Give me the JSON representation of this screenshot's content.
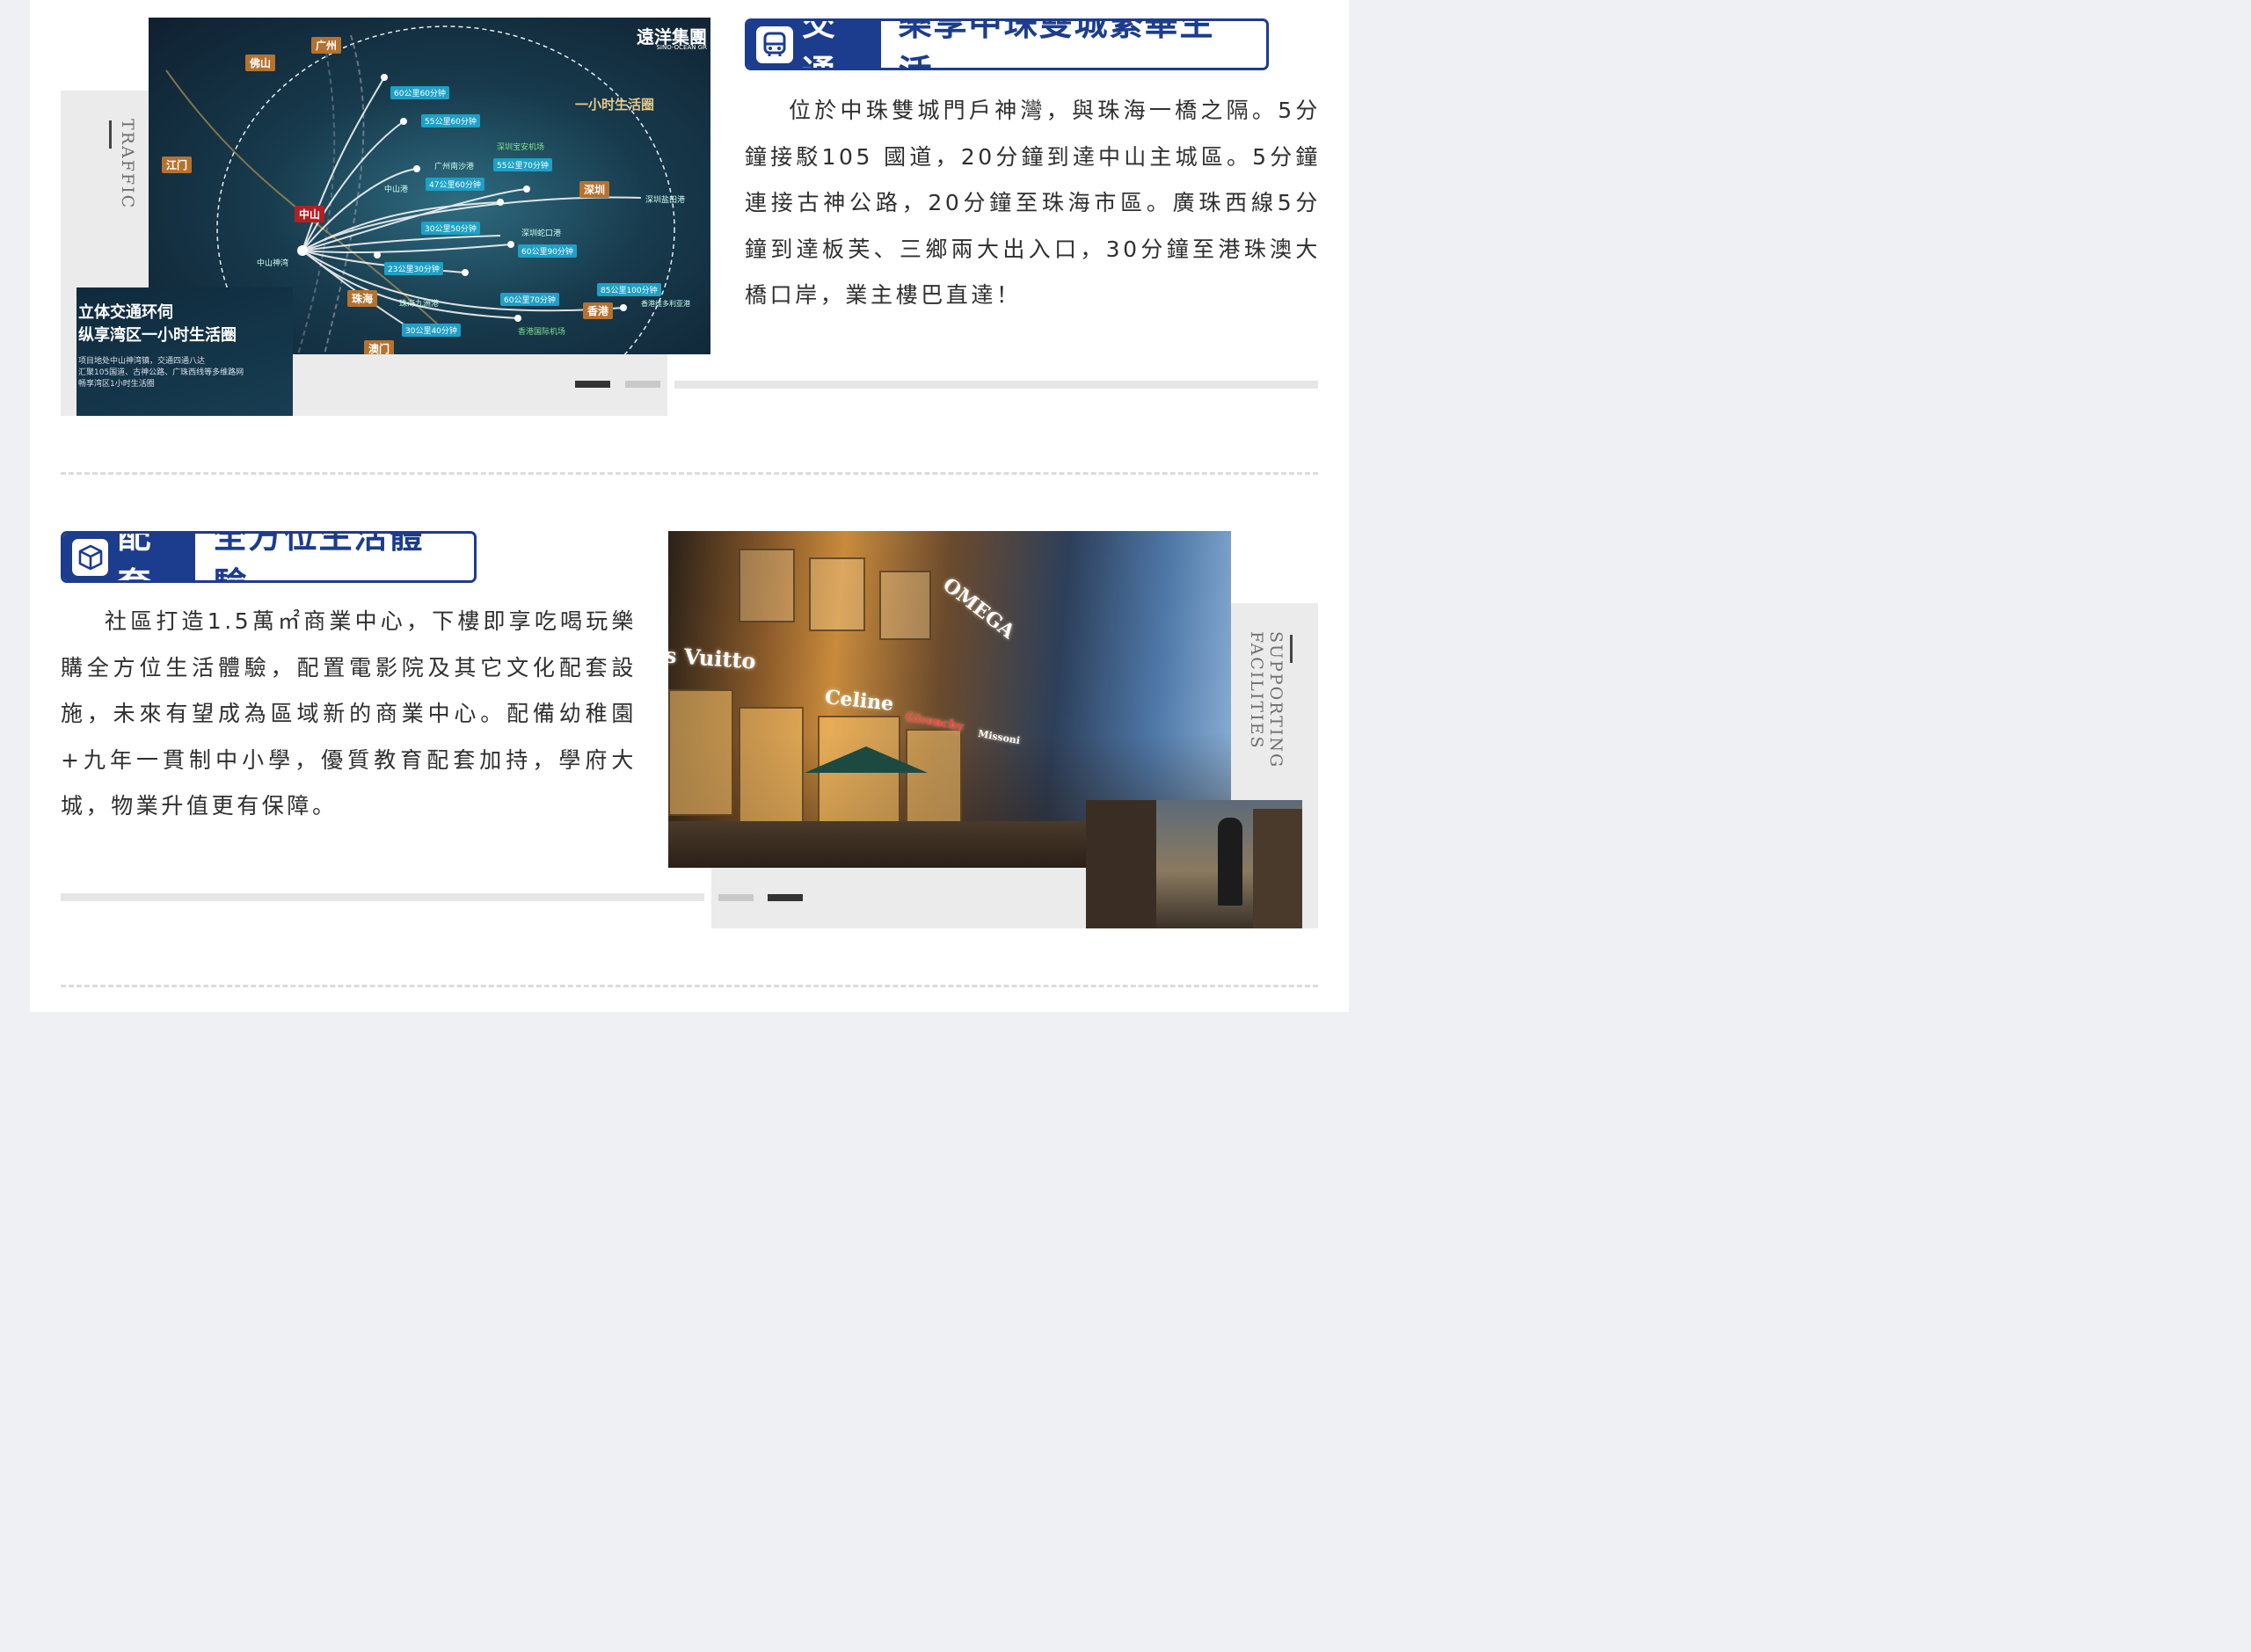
{
  "traffic": {
    "side_label": "TRAFFIC",
    "tag_label": "交通",
    "title": "樂享中珠雙城繁華生活",
    "body": "位於中珠雙城門戶神灣，與珠海一橋之隔。5分鐘接駁105 國道，20分鐘到達中山主城區。5分鐘連接古神公路，20分鐘至珠海市區。廣珠西線5分鐘到達板芙、三鄉兩大出入口，30分鐘至港珠澳大橋口岸，業主樓巴直達！",
    "icon": "bus-icon",
    "map": {
      "circle_label": "一小时生活圈",
      "developer": "遠洋集團",
      "developer_en": "SINO-OCEAN GR",
      "cities": [
        "佛山",
        "广州",
        "江门",
        "中山",
        "深圳",
        "珠海",
        "香港",
        "澳门"
      ],
      "time_pills": [
        "60公里60分钟",
        "55公里60分钟",
        "55公里70分钟",
        "47公里60分钟",
        "30公里50分钟",
        "60公里90分钟",
        "23公里30分钟",
        "60公里70分钟",
        "85公里100分钟",
        "30公里40分钟"
      ],
      "places": [
        "深圳宝安机场",
        "广州南沙港",
        "中山港",
        "深圳盐田港",
        "深圳蛇口港",
        "中山神湾",
        "珠海九洲港",
        "香港国际机场",
        "香港维多利亚港"
      ],
      "inset_title_1": "立体交通环伺",
      "inset_title_2": "纵享湾区一小时生活圈",
      "inset_text_1": "项目地处中山神湾镇，交通四通八达",
      "inset_text_2": "汇聚105国道、古神公路、广珠西线等多维路网",
      "inset_text_3": "畅享湾区1小时生活圈"
    }
  },
  "supporting": {
    "side_label": "SUPPORTING FACILITIES",
    "tag_label": "配套",
    "title": "全方位生活體驗",
    "body": "社區打造1.5萬㎡商業中心，下樓即享吃喝玩樂購全方位生活體驗，配置電影院及其它文化配套設施，未來有望成為區域新的商業中心。配備幼稚園+九年一貫制中小學，優質教育配套加持，學府大城，物業升值更有保障。",
    "icon": "cube-icon",
    "photo_brands": [
      "s Vuitto",
      "Celine",
      "OMEGA",
      "Givenchy",
      "Missoni"
    ]
  },
  "colors": {
    "accent": "#1c3c8e",
    "panel_grey": "#ebebeb",
    "text": "#2f2f2f"
  }
}
